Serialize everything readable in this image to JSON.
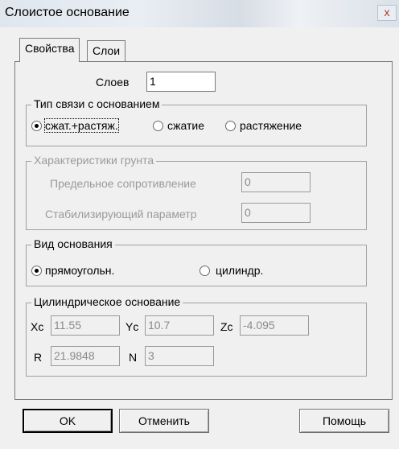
{
  "window": {
    "title": "Слоистое основание",
    "close_glyph": "x"
  },
  "tabs": [
    {
      "label": "Свойства",
      "active": true
    },
    {
      "label": "Слои",
      "active": false
    }
  ],
  "layers": {
    "label": "Слоев",
    "value": "1"
  },
  "bond_type": {
    "title": "Тип связи с основанием",
    "options": [
      {
        "label": "сжат.+растяж.",
        "selected": true
      },
      {
        "label": "сжатие",
        "selected": false
      },
      {
        "label": "растяжение",
        "selected": false
      }
    ]
  },
  "soil": {
    "title": "Характеристики грунта",
    "enabled": false,
    "limit_resistance_label": "Предельное сопротивление",
    "limit_resistance_value": "0",
    "stabilizing_param_label": "Стабилизирующий параметр",
    "stabilizing_param_value": "0"
  },
  "base_type": {
    "title": "Вид основания",
    "options": [
      {
        "label": "прямоугольн.",
        "selected": true
      },
      {
        "label": "цилиндр.",
        "selected": false
      }
    ]
  },
  "cylindrical": {
    "title": "Цилиндрическое основание",
    "xc_label": "Xc",
    "xc_value": "11.55",
    "yc_label": "Yc",
    "yc_value": "10.7",
    "zc_label": "Zc",
    "zc_value": "-4.095",
    "r_label": "R",
    "r_value": "21.9848",
    "n_label": "N",
    "n_value": "3"
  },
  "buttons": {
    "ok": "OK",
    "cancel": "Отменить",
    "help": "Помощь"
  }
}
